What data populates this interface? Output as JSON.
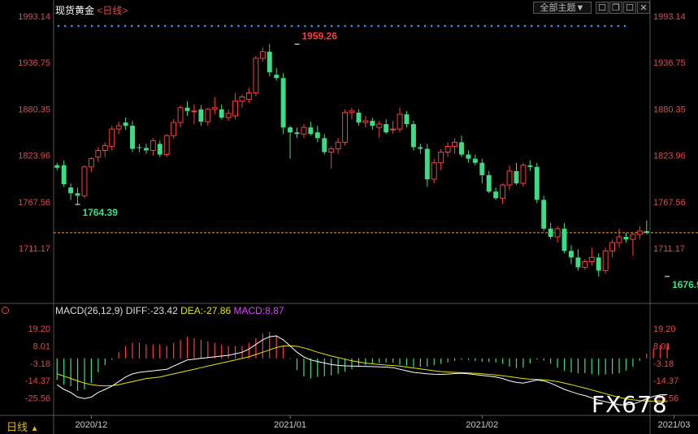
{
  "header": {
    "title": "现货黄金",
    "period": "<日线>",
    "dropdown_label": "全部主题▼"
  },
  "window_buttons": [
    "☐",
    "❐",
    "☐",
    "✕"
  ],
  "colors": {
    "up": "#ff3d3d",
    "down": "#3ddc84",
    "axis_label": "#e04a4a",
    "diff_line": "#ffffff",
    "dea_line": "#e6e600",
    "macd_label": "#e040fb",
    "grid_dot": "#3399ff"
  },
  "bottom": {
    "period_tab": "日线",
    "tab_arrow": "▲",
    "watermark": "FX678"
  },
  "chart_data": [
    {
      "type": "candlestick",
      "title": "",
      "ylim": [
        1656.0,
        1993.14
      ],
      "y_ticks": [
        "1993.14",
        "1936.75",
        "1880.35",
        "1823.96",
        "1767.56",
        "1711.17"
      ],
      "y_tick_values": [
        1993.14,
        1936.75,
        1880.35,
        1823.96,
        1767.56,
        1711.17
      ],
      "x_ticks": [
        {
          "label": "2020/12",
          "index": 5
        },
        {
          "label": "2021/01",
          "index": 34
        },
        {
          "label": "2021/02",
          "index": 62
        },
        {
          "label": "2021/03",
          "index": 90
        }
      ],
      "current_price": 1730.0,
      "annotations": [
        {
          "text": "1959.26",
          "index": 35,
          "value": 1959.26,
          "type": "high"
        },
        {
          "text": "1764.39",
          "index": 3,
          "value": 1764.39,
          "type": "low"
        },
        {
          "text": "1676.91",
          "index": 89,
          "value": 1676.91,
          "type": "low"
        }
      ],
      "candles": [
        [
          1812,
          1815,
          1806,
          1809
        ],
        [
          1812,
          1818,
          1786,
          1789
        ],
        [
          1785,
          1790,
          1770,
          1778
        ],
        [
          1778,
          1785,
          1764.39,
          1775
        ],
        [
          1775,
          1812,
          1772,
          1810
        ],
        [
          1810,
          1822,
          1804,
          1820
        ],
        [
          1822,
          1834,
          1816,
          1830
        ],
        [
          1830,
          1840,
          1822,
          1836
        ],
        [
          1835,
          1860,
          1830,
          1856
        ],
        [
          1856,
          1865,
          1850,
          1860
        ],
        [
          1864,
          1870,
          1855,
          1860
        ],
        [
          1860,
          1866,
          1828,
          1832
        ],
        [
          1834,
          1838,
          1828,
          1833
        ],
        [
          1833,
          1838,
          1826,
          1830
        ],
        [
          1830,
          1845,
          1824,
          1842
        ],
        [
          1838,
          1842,
          1822,
          1825
        ],
        [
          1825,
          1850,
          1822,
          1848
        ],
        [
          1848,
          1868,
          1844,
          1864
        ],
        [
          1864,
          1885,
          1858,
          1882
        ],
        [
          1882,
          1890,
          1872,
          1878
        ],
        [
          1878,
          1886,
          1862,
          1878
        ],
        [
          1880,
          1885,
          1860,
          1865
        ],
        [
          1865,
          1882,
          1860,
          1880
        ],
        [
          1880,
          1895,
          1874,
          1882
        ],
        [
          1880,
          1886,
          1868,
          1870
        ],
        [
          1870,
          1880,
          1866,
          1875
        ],
        [
          1872,
          1900,
          1868,
          1890
        ],
        [
          1890,
          1898,
          1882,
          1895
        ],
        [
          1892,
          1906,
          1888,
          1900
        ],
        [
          1900,
          1945,
          1896,
          1942
        ],
        [
          1942,
          1955,
          1938,
          1950
        ],
        [
          1950,
          1959.26,
          1920,
          1925
        ],
        [
          1922,
          1930,
          1915,
          1918
        ],
        [
          1918,
          1924,
          1850,
          1858
        ],
        [
          1858,
          1860,
          1820,
          1852
        ],
        [
          1852,
          1858,
          1845,
          1850
        ],
        [
          1850,
          1862,
          1845,
          1858
        ],
        [
          1858,
          1865,
          1848,
          1850
        ],
        [
          1852,
          1860,
          1840,
          1845
        ],
        [
          1845,
          1850,
          1825,
          1828
        ],
        [
          1828,
          1835,
          1808,
          1832
        ],
        [
          1832,
          1845,
          1826,
          1840
        ],
        [
          1840,
          1880,
          1836,
          1876
        ],
        [
          1876,
          1882,
          1868,
          1878
        ],
        [
          1876,
          1880,
          1860,
          1864
        ],
        [
          1864,
          1872,
          1858,
          1866
        ],
        [
          1866,
          1870,
          1855,
          1860
        ],
        [
          1858,
          1866,
          1845,
          1862
        ],
        [
          1862,
          1868,
          1850,
          1852
        ],
        [
          1856,
          1866,
          1850,
          1856
        ],
        [
          1856,
          1882,
          1852,
          1874
        ],
        [
          1874,
          1878,
          1858,
          1862
        ],
        [
          1862,
          1866,
          1830,
          1834
        ],
        [
          1834,
          1838,
          1826,
          1832
        ],
        [
          1832,
          1838,
          1786,
          1795
        ],
        [
          1795,
          1820,
          1790,
          1815
        ],
        [
          1815,
          1832,
          1806,
          1828
        ],
        [
          1828,
          1840,
          1822,
          1835
        ],
        [
          1835,
          1845,
          1826,
          1840
        ],
        [
          1840,
          1848,
          1822,
          1825
        ],
        [
          1825,
          1830,
          1815,
          1820
        ],
        [
          1820,
          1825,
          1812,
          1815
        ],
        [
          1815,
          1820,
          1790,
          1800
        ],
        [
          1800,
          1805,
          1778,
          1780
        ],
        [
          1780,
          1785,
          1770,
          1772
        ],
        [
          1772,
          1790,
          1765,
          1788
        ],
        [
          1788,
          1812,
          1782,
          1805
        ],
        [
          1805,
          1815,
          1788,
          1790
        ],
        [
          1790,
          1815,
          1786,
          1812
        ],
        [
          1812,
          1818,
          1805,
          1810
        ],
        [
          1810,
          1815,
          1766,
          1770
        ],
        [
          1770,
          1775,
          1732,
          1735
        ],
        [
          1735,
          1742,
          1722,
          1725
        ],
        [
          1725,
          1738,
          1718,
          1735
        ],
        [
          1735,
          1742,
          1705,
          1708
        ],
        [
          1708,
          1715,
          1692,
          1700
        ],
        [
          1700,
          1710,
          1684,
          1688
        ],
        [
          1688,
          1698,
          1685,
          1695
        ],
        [
          1695,
          1712,
          1690,
          1700
        ],
        [
          1700,
          1705,
          1676.91,
          1684
        ],
        [
          1684,
          1712,
          1680,
          1708
        ],
        [
          1708,
          1722,
          1700,
          1718
        ],
        [
          1718,
          1735,
          1712,
          1725
        ],
        [
          1725,
          1730,
          1718,
          1722
        ],
        [
          1722,
          1730,
          1702,
          1728
        ],
        [
          1728,
          1738,
          1722,
          1732
        ],
        [
          1732,
          1745,
          1728,
          1730
        ]
      ]
    },
    {
      "type": "histogram+line",
      "indicator": "MACD(26,12,9)",
      "legend": [
        {
          "label": "DIFF:-23.42",
          "color_key": "diff_line"
        },
        {
          "label": "DEA:-27.86",
          "color_key": "dea_line"
        },
        {
          "label": "MACD:8.87",
          "color_key": "macd_label"
        }
      ],
      "ylim": [
        -30.5,
        24.0
      ],
      "y_ticks": [
        "19.20",
        "8.01",
        "-3.18",
        "-14.37",
        "-25.56"
      ],
      "y_tick_values": [
        19.2,
        8.01,
        -3.18,
        -14.37,
        -25.56
      ],
      "diff": [
        -17,
        -20,
        -22,
        -25,
        -26,
        -25,
        -22,
        -20,
        -18,
        -15,
        -12,
        -10,
        -9,
        -8.5,
        -8,
        -7.5,
        -7,
        -5,
        -3,
        -1,
        -0.5,
        0,
        0.5,
        1,
        1.5,
        2,
        3,
        4,
        6,
        9,
        12,
        14,
        14.5,
        12,
        8,
        4,
        1,
        -1,
        -2,
        -3,
        -4,
        -4.5,
        -4.8,
        -5,
        -5.1,
        -5.2,
        -5.3,
        -5.5,
        -5.6,
        -6,
        -7,
        -8,
        -9,
        -9.5,
        -10,
        -10.2,
        -10.3,
        -10.1,
        -9.8,
        -9.6,
        -9.9,
        -10.5,
        -11,
        -11.5,
        -12,
        -13,
        -14.5,
        -15.5,
        -16,
        -15,
        -14,
        -14.5,
        -16,
        -18,
        -20,
        -21.5,
        -23,
        -24,
        -25.5,
        -27,
        -28,
        -29,
        -30,
        -30,
        -29.5,
        -28,
        -26,
        -24.5,
        -23.5,
        -23.42
      ],
      "dea": [
        -10,
        -11.5,
        -13,
        -14.5,
        -16,
        -17,
        -17.5,
        -17.8,
        -17.6,
        -17,
        -16,
        -15,
        -14,
        -13,
        -12.5,
        -12,
        -11,
        -10,
        -9,
        -8,
        -7,
        -6,
        -5,
        -4,
        -3,
        -2,
        -1,
        0,
        1,
        2.5,
        4,
        5.5,
        7,
        8,
        8.2,
        7.8,
        6.8,
        5.5,
        4,
        2.8,
        1.5,
        0.5,
        -0.5,
        -1.5,
        -2.3,
        -3,
        -3.5,
        -4,
        -4.3,
        -4.6,
        -5,
        -5.6,
        -6.2,
        -6.8,
        -7.4,
        -8,
        -8.5,
        -8.8,
        -9,
        -9.2,
        -9.4,
        -9.6,
        -9.9,
        -10.3,
        -10.7,
        -11.2,
        -11.8,
        -12.4,
        -13,
        -13.4,
        -13.6,
        -13.8,
        -14.3,
        -15,
        -16,
        -17,
        -18.1,
        -19.2,
        -20.4,
        -21.6,
        -22.8,
        -24,
        -25.2,
        -26.1,
        -26.8,
        -27.2,
        -27.5,
        -27.7,
        -27.8,
        -27.86
      ],
      "macd": [
        -14,
        -17,
        -18,
        -21,
        -20,
        -16,
        -9,
        -4.4,
        -0.8,
        4,
        8,
        10,
        10,
        9,
        9,
        9,
        8,
        10,
        12,
        14,
        13,
        12,
        11,
        10,
        9,
        8,
        8,
        8,
        10,
        13,
        16,
        17,
        15,
        8,
        -0.4,
        -7.6,
        -11.6,
        -13,
        -12,
        -11.6,
        -11,
        -10,
        -8.6,
        -7,
        -5.6,
        -4.4,
        -3.6,
        -3,
        -2.6,
        -2.8,
        -4,
        -4.8,
        -5.6,
        -5.4,
        -5.2,
        -4.4,
        -3.6,
        -2.6,
        -1.6,
        -0.8,
        -1,
        -1.8,
        -2.2,
        -2.4,
        -2.6,
        -3.6,
        -5.4,
        -6.2,
        -6,
        -3.2,
        -0.8,
        -1.4,
        -3.4,
        -6,
        -8,
        -9,
        -9.8,
        -9.6,
        -10.2,
        -10.8,
        -10.4,
        -10,
        -9.6,
        -7.8,
        -5.4,
        -1.6,
        3.0,
        6.4,
        8.6,
        8.87
      ]
    }
  ]
}
